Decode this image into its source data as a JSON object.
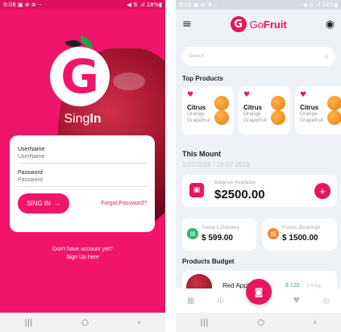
{
  "signin_screen": {
    "status": {
      "time": "9:08",
      "icons": "▣ ⊗ ⊗ ··",
      "right": "◀ ⇅ .ıl 18%▮"
    },
    "title_light": "Sing",
    "title_bold": "In",
    "username_label": "UserName",
    "username_placeholder": "UserName",
    "password_label": "Password",
    "password_placeholder": "Password",
    "signin_button": "SING IN",
    "signin_arrow": "→",
    "forgot_link": "Forgot Password?",
    "no_account_text": "Don't have account yet?",
    "signup_link": "Sign Up here",
    "nav": {
      "recents": "|||",
      "home": "○",
      "back": "‹"
    },
    "colors": {
      "primary": "#f0156a",
      "leaf_green": "#1aa64a",
      "leaf_dark": "#222222"
    }
  },
  "home_screen": {
    "status": {
      "time": "9:09",
      "icons": "▣ ⊗ ⊗ ··",
      "right": "◀ ⇅ .ıl 18%▮"
    },
    "brand_light": "Go",
    "brand_bold": "Fruit",
    "menu_icon": "≡",
    "profile_icon": "◉",
    "search_placeholder": "Search",
    "search_icon": "⌕",
    "top_products_title": "Top Products",
    "products": [
      {
        "name": "Citrus",
        "line1": "Orange",
        "line2": "Grapefruit"
      },
      {
        "name": "Citrus",
        "line1": "Orange",
        "line2": "Grapefruit"
      },
      {
        "name": "Citrus",
        "line1": "Orange",
        "line2": "Grapefruit"
      }
    ],
    "heart_icon": "♥",
    "month_title": "This Mount",
    "date_range": "1/07/2019 - 28-07-2019",
    "balance_label": "Balance Available",
    "balance_value": "$2500.00",
    "plus_label": "+",
    "delivery_label": "Today's Delivery",
    "delivery_value": "$ 599.00",
    "bookings_label": "Future Bookings",
    "bookings_value": "$ 1500.00",
    "budget_title": "Products Budget",
    "budget_item": {
      "name": "Red Apple",
      "price": "$ 120",
      "weight": "1.0 kg"
    },
    "tabs": {
      "store": "▦",
      "stats": "ılı",
      "favorites": "♥",
      "profile": "◎"
    },
    "fab_icon": "◙",
    "nav": {
      "recents": "|||",
      "home": "○",
      "back": "‹"
    },
    "colors": {
      "primary": "#e8155e",
      "delivery_green": "#2ab673",
      "bookings_orange": "#f0892c"
    }
  }
}
